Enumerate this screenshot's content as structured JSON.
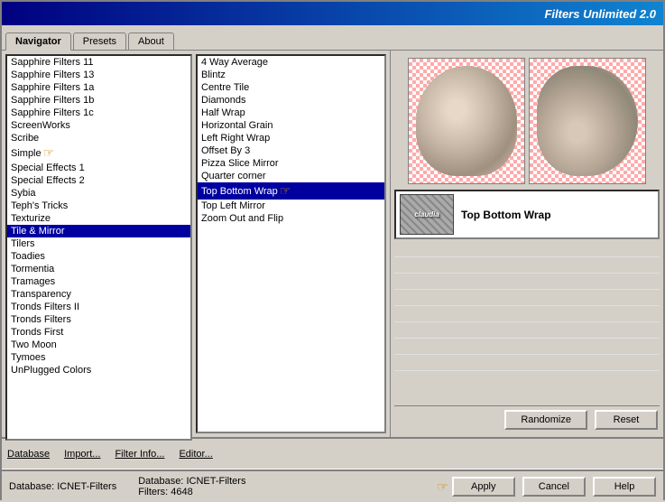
{
  "titleBar": {
    "title": "Filters Unlimited 2.0"
  },
  "tabs": [
    {
      "label": "Navigator",
      "active": true
    },
    {
      "label": "Presets",
      "active": false
    },
    {
      "label": "About",
      "active": false
    }
  ],
  "categories": [
    "Sapphire Filters 11",
    "Sapphire Filters 13",
    "Sapphire Filters 1a",
    "Sapphire Filters 1b",
    "Sapphire Filters 1c",
    "ScreenWorks",
    "Scribe",
    "Simple",
    "Special Effects 1",
    "Special Effects 2",
    "Sybia",
    "Teph's Tricks",
    "Texturize",
    "Tile & Mirror",
    "Tilers",
    "Toadies",
    "Tormentia",
    "Tramages",
    "Transparency",
    "Tronds Filters II",
    "Tronds Filters",
    "Tronds First",
    "Two Moon",
    "Tymoes",
    "UnPlugged Colors"
  ],
  "selectedCategory": "Tile & Mirror",
  "filters": [
    "4 Way Average",
    "Blintz",
    "Centre Tile",
    "Diamonds",
    "Half Wrap",
    "Horizontal Grain",
    "Left Right Wrap",
    "Offset By 3",
    "Pizza Slice Mirror",
    "Quarter corner",
    "Top Bottom Wrap",
    "Top Left Mirror",
    "Zoom Out and Flip"
  ],
  "selectedFilter": "Top Bottom Wrap",
  "preview": {
    "filterName": "Top Bottom Wrap",
    "thumbLabel": "claudia"
  },
  "toolbar": {
    "database": "Database",
    "import": "Import...",
    "filterInfo": "Filter Info...",
    "editor": "Editor...",
    "randomize": "Randomize",
    "reset": "Reset"
  },
  "statusBar": {
    "databaseLabel": "Database:",
    "databaseValue": "ICNET-Filters",
    "filtersLabel": "Filters:",
    "filtersValue": "4648",
    "apply": "Apply",
    "cancel": "Cancel",
    "help": "Help"
  }
}
